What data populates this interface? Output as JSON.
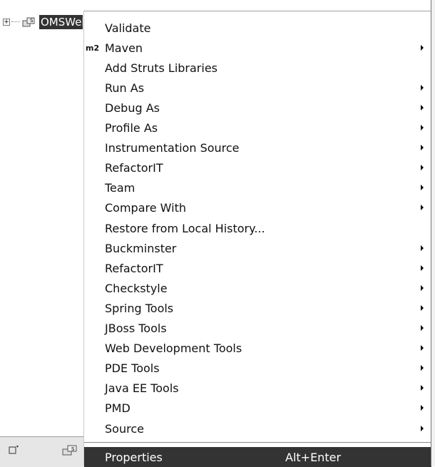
{
  "tree": {
    "project_label": "OMSWeb"
  },
  "menu": {
    "items": [
      {
        "label": "Validate",
        "submenu": false,
        "prefix": ""
      },
      {
        "label": "Maven",
        "submenu": true,
        "prefix": "m2"
      },
      {
        "label": "Add Struts Libraries",
        "submenu": false,
        "prefix": ""
      },
      {
        "label": "Run As",
        "submenu": true,
        "prefix": ""
      },
      {
        "label": "Debug As",
        "submenu": true,
        "prefix": ""
      },
      {
        "label": "Profile As",
        "submenu": true,
        "prefix": ""
      },
      {
        "label": "Instrumentation Source",
        "submenu": true,
        "prefix": ""
      },
      {
        "label": "RefactorIT",
        "submenu": true,
        "prefix": ""
      },
      {
        "label": "Team",
        "submenu": true,
        "prefix": ""
      },
      {
        "label": "Compare With",
        "submenu": true,
        "prefix": ""
      },
      {
        "label": "Restore from Local History...",
        "submenu": false,
        "prefix": ""
      },
      {
        "label": "Buckminster",
        "submenu": true,
        "prefix": ""
      },
      {
        "label": "RefactorIT",
        "submenu": true,
        "prefix": ""
      },
      {
        "label": "Checkstyle",
        "submenu": true,
        "prefix": ""
      },
      {
        "label": "Spring Tools",
        "submenu": true,
        "prefix": ""
      },
      {
        "label": "JBoss Tools",
        "submenu": true,
        "prefix": ""
      },
      {
        "label": "Web Development Tools",
        "submenu": true,
        "prefix": ""
      },
      {
        "label": "PDE Tools",
        "submenu": true,
        "prefix": ""
      },
      {
        "label": "Java EE Tools",
        "submenu": true,
        "prefix": ""
      },
      {
        "label": "PMD",
        "submenu": true,
        "prefix": ""
      },
      {
        "label": "Source",
        "submenu": true,
        "prefix": ""
      }
    ],
    "properties": {
      "label": "Properties",
      "accelerator": "Alt+Enter"
    }
  },
  "colors": {
    "highlight": "#333333",
    "highlight_text": "#ffffff"
  },
  "icons": [
    "tree-expander-icon",
    "project-icon",
    "view-menu-icon",
    "project-small-icon",
    "submenu-arrow-icon"
  ]
}
